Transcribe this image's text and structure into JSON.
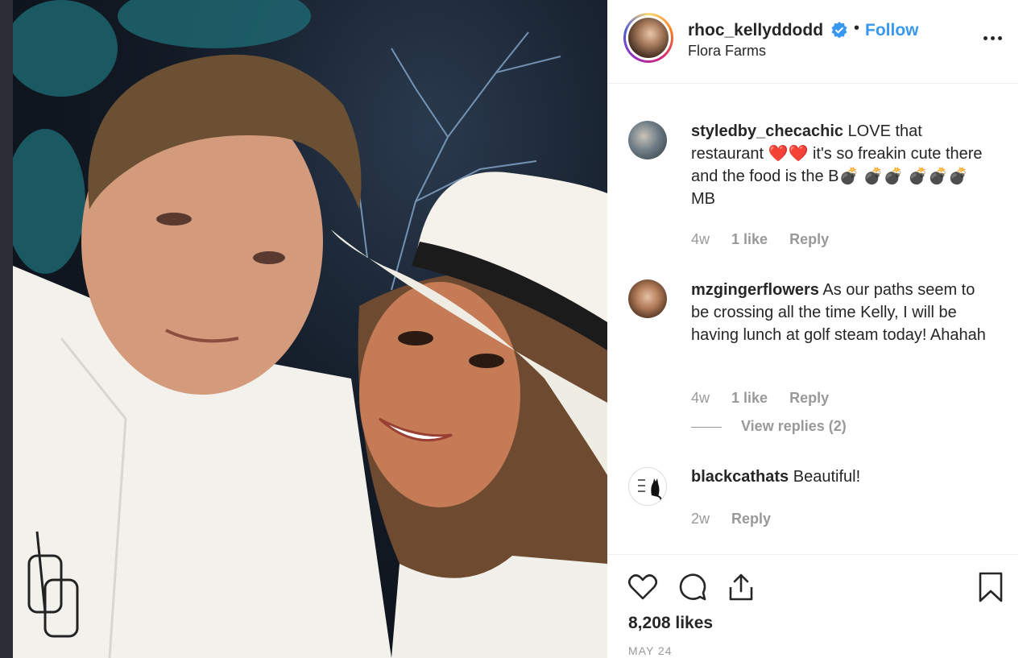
{
  "post": {
    "username": "rhoc_kellyddodd",
    "separator": "•",
    "follow_label": "Follow",
    "location": "Flora Farms",
    "verified": true
  },
  "comments": [
    {
      "username": "styledby_checachic",
      "text": "LOVE that restaurant ❤️❤️ it's so freakin cute there and the food is the B💣 💣💣 💣💣💣MB",
      "age": "4w",
      "likes": "1 like",
      "reply_label": "Reply"
    },
    {
      "username": "mzgingerflowers",
      "text": "As our paths seem to be crossing all the time Kelly, I will be having lunch at golf steam today! Ahahah",
      "age": "4w",
      "likes": "1 like",
      "reply_label": "Reply",
      "view_replies": "View replies (2)"
    },
    {
      "username": "blackcathats",
      "text": "Beautiful!",
      "age": "2w",
      "reply_label": "Reply"
    }
  ],
  "footer": {
    "likes": "8,208 likes",
    "date": "MAY 24"
  },
  "icons": [
    "heart-icon",
    "comment-icon",
    "share-icon",
    "bookmark-icon",
    "more-icon",
    "verified-icon"
  ],
  "colors": {
    "link": "#3897f0",
    "text": "#262626",
    "muted": "#999999"
  }
}
